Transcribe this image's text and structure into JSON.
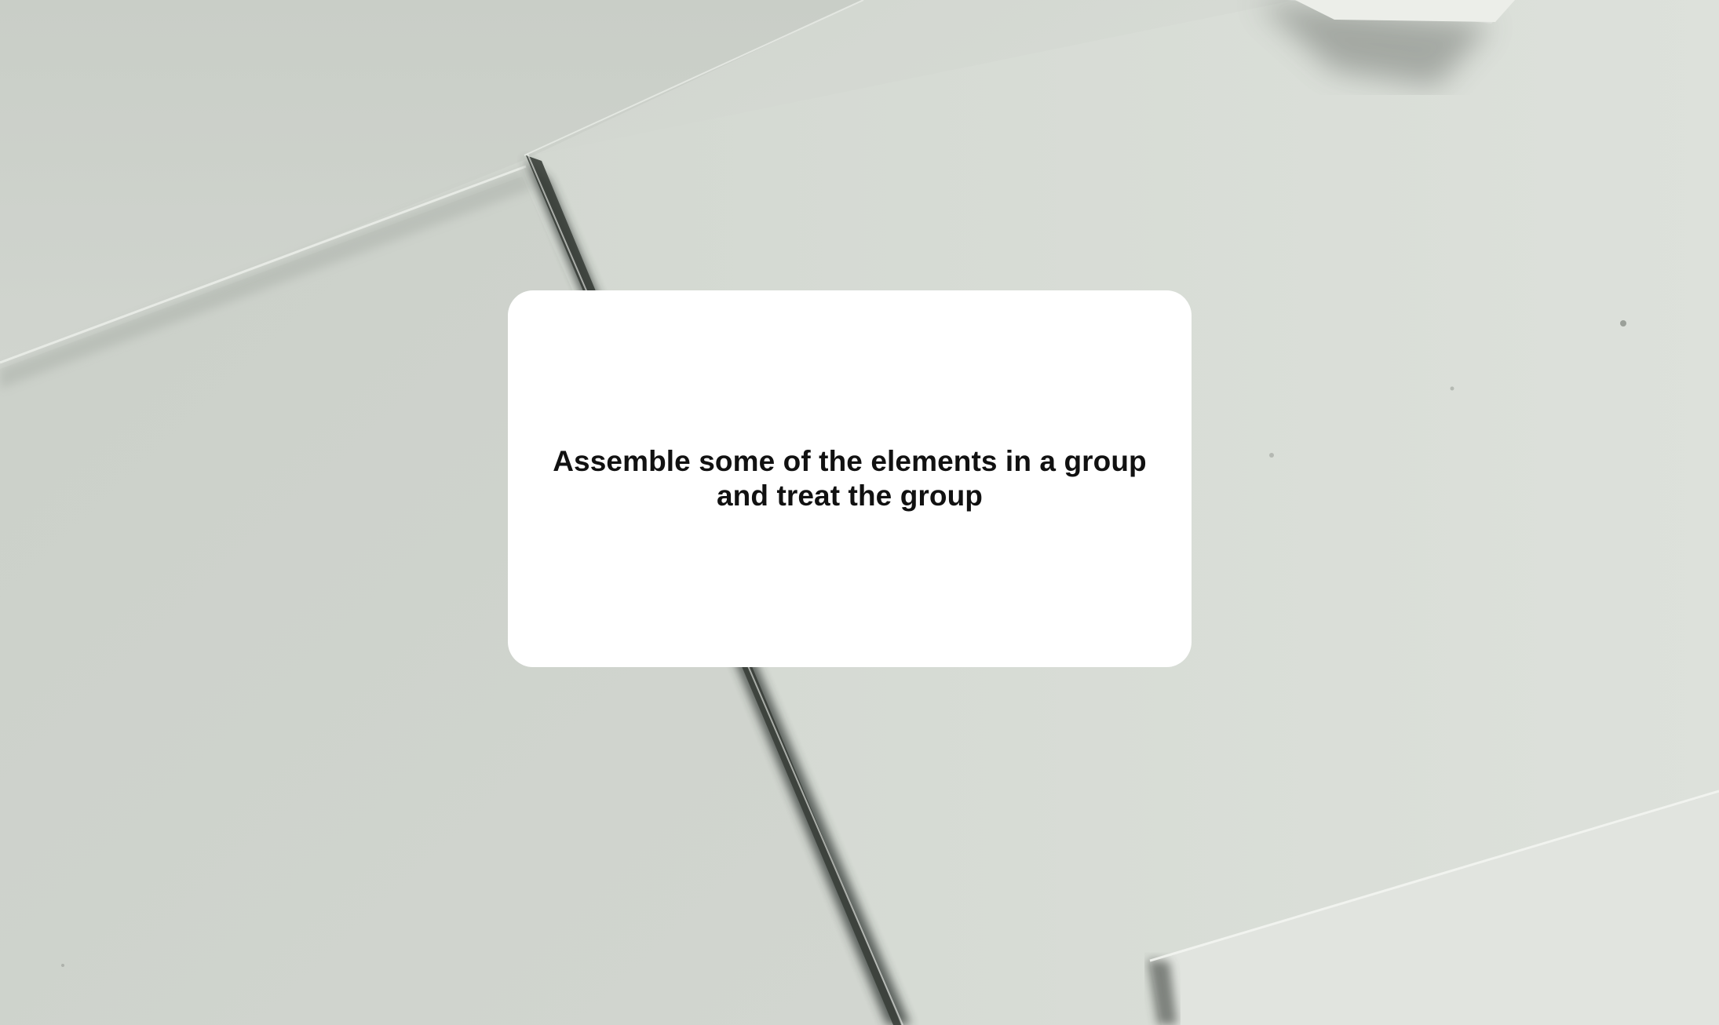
{
  "card": {
    "text": "Assemble some of the elements in a group and treat the group"
  },
  "background": {
    "description_icon": "paper-sheets-background",
    "base_color": "#d6dbd5",
    "shadow_color": "#2f3430"
  }
}
